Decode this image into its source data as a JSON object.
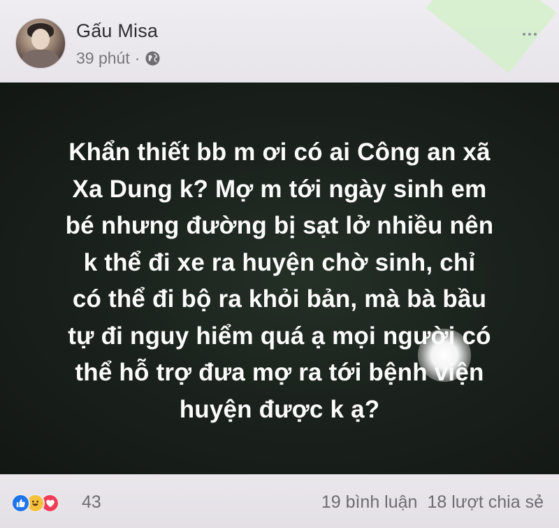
{
  "post": {
    "author_name": "Gấu Misa",
    "time": "39 phút",
    "separator": "·",
    "privacy_icon": "globe-icon",
    "text": "Khẩn thiết bb m ơi có ai Công an xã\nXa Dung k? Mợ m tới ngày sinh em\nbé nhưng đường bị sạt lở nhiều nên\nk thể đi xe ra huyện chờ sinh, chỉ\ncó thể đi bộ ra khỏi bản, mà bà bầu\ntự đi nguy hiểm quá ạ mọi người có\nthể hỗ trợ đưa mợ ra tới bệnh viện\nhuyện được k ạ?",
    "background_color": "#1b221d",
    "text_color": "#fbfbfb"
  },
  "footer": {
    "reaction_icons": [
      "like-icon",
      "haha-icon",
      "love-icon"
    ],
    "reaction_count": "43",
    "comments": "19 bình luận",
    "shares": "18 lượt chia sẻ"
  },
  "colors": {
    "like": "#1f74ea",
    "haha": "#f6c23c",
    "love": "#ef3d55"
  }
}
